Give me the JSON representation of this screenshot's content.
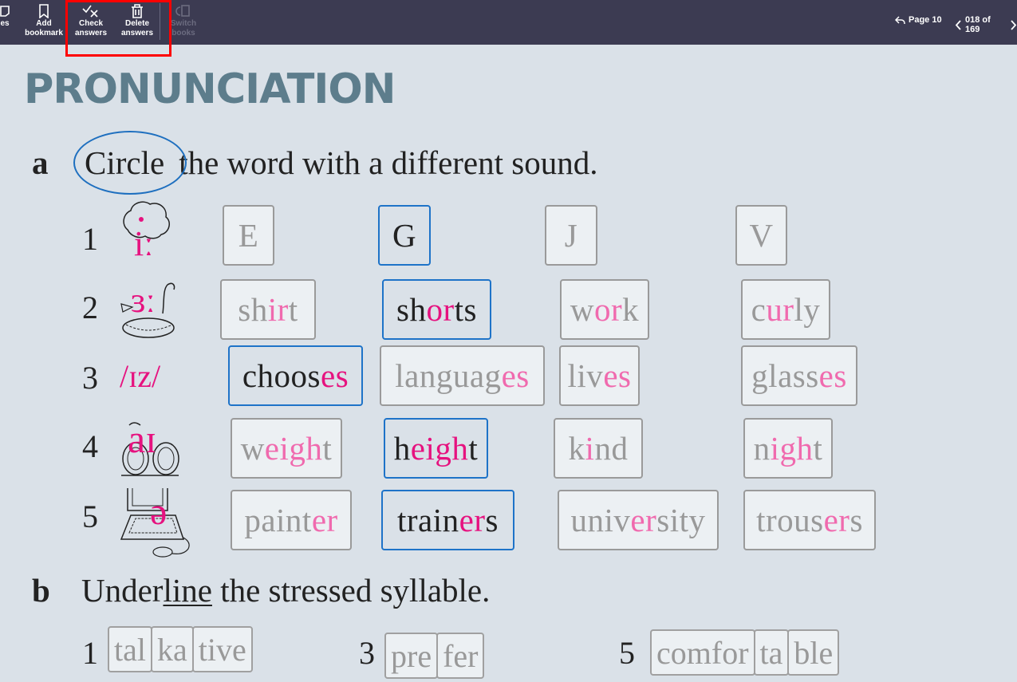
{
  "toolbar": {
    "buttons": [
      {
        "label_line1": "",
        "label_line2": "es",
        "icon": "notes-icon"
      },
      {
        "label_line1": "Add",
        "label_line2": "bookmark",
        "icon": "bookmark-icon"
      },
      {
        "label_line1": "Check",
        "label_line2": "answers",
        "icon": "check-answers-icon"
      },
      {
        "label_line1": "Delete",
        "label_line2": "answers",
        "icon": "trash-icon"
      },
      {
        "label_line1": "Switch",
        "label_line2": "books",
        "icon": "switch-books-icon",
        "disabled": true
      }
    ],
    "back_to_page": "Page 10",
    "page_indicator": "018 of 169"
  },
  "page": {
    "title": "PRONUNCIATION",
    "section_a": {
      "letter": "a",
      "circled_word": "Circle",
      "rest": "the word with a different sound.",
      "rows": [
        {
          "num": "1",
          "phoneme": "iː",
          "picture": "tree",
          "words": [
            {
              "pre": "E",
              "hl": "",
              "post": "",
              "selected": false
            },
            {
              "pre": "G",
              "hl": "",
              "post": "",
              "selected": true
            },
            {
              "pre": "J",
              "hl": "",
              "post": "",
              "selected": false
            },
            {
              "pre": "V",
              "hl": "",
              "post": "",
              "selected": false
            }
          ]
        },
        {
          "num": "2",
          "phoneme": "ɜː",
          "picture": "bird",
          "words": [
            {
              "pre": "sh",
              "hl": "ir",
              "post": "t",
              "selected": false
            },
            {
              "pre": "sh",
              "hl": "or",
              "post": "ts",
              "selected": true
            },
            {
              "pre": "w",
              "hl": "or",
              "post": "k",
              "selected": false
            },
            {
              "pre": "c",
              "hl": "ur",
              "post": "ly",
              "selected": false
            }
          ]
        },
        {
          "num": "3",
          "phoneme": "/ɪz/",
          "picture": "",
          "words": [
            {
              "pre": "choos",
              "hl": "es",
              "post": "",
              "selected": true
            },
            {
              "pre": "languag",
              "hl": "es",
              "post": "",
              "selected": false
            },
            {
              "pre": "liv",
              "hl": "es",
              "post": "",
              "selected": false
            },
            {
              "pre": "glass",
              "hl": "es",
              "post": "",
              "selected": false
            }
          ]
        },
        {
          "num": "4",
          "phoneme": "aɪ",
          "picture": "bike",
          "words": [
            {
              "pre": "w",
              "hl": "eigh",
              "post": "t",
              "selected": false
            },
            {
              "pre": "h",
              "hl": "eigh",
              "post": "t",
              "selected": true
            },
            {
              "pre": "k",
              "hl": "i",
              "post": "nd",
              "selected": false
            },
            {
              "pre": "n",
              "hl": "igh",
              "post": "t",
              "selected": false
            }
          ]
        },
        {
          "num": "5",
          "phoneme": "ə",
          "picture": "computer",
          "words": [
            {
              "pre": "paint",
              "hl": "er",
              "post": "",
              "selected": false
            },
            {
              "pre": "train",
              "hl": "er",
              "post": "s",
              "selected": true
            },
            {
              "pre": "univ",
              "hl": "er",
              "post": "sity",
              "selected": false
            },
            {
              "pre": "trous",
              "hl": "er",
              "post": "s",
              "selected": false
            }
          ]
        }
      ]
    },
    "section_b": {
      "letter": "b",
      "pre": "Under",
      "underlined": "line",
      "rest": " the stressed syllable.",
      "items": [
        {
          "num": "1",
          "syllables": [
            "tal",
            "ka",
            "tive"
          ]
        },
        {
          "num": "3",
          "syllables": [
            "pre",
            "fer"
          ]
        },
        {
          "num": "5",
          "syllables": [
            "comfor",
            "ta",
            "ble"
          ]
        }
      ]
    }
  },
  "colors": {
    "toolbar_bg": "#3c3b52",
    "page_bg": "#dae1e8",
    "title": "#5d7d8c",
    "phoneme_pink": "#e6127f",
    "selected_border": "#1e73c8",
    "highlight_red": "#ff0000"
  }
}
